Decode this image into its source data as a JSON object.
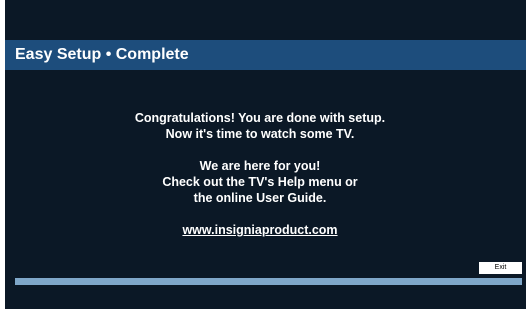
{
  "header": {
    "title": "Easy Setup • Complete"
  },
  "message": {
    "line1": "Congratulations! You are done with setup.",
    "line2": "Now it's time to watch some TV.",
    "line3": "We are here for you!",
    "line4": "Check out the TV's Help menu or",
    "line5": "the online User Guide.",
    "link": "www.insigniaproduct.com"
  },
  "buttons": {
    "exit_label": "Exit"
  },
  "progress": {
    "fraction": 1.0
  },
  "colors": {
    "background": "#0b1826",
    "title_bar": "#1d4d7c",
    "progress": "#7fa7c9"
  }
}
